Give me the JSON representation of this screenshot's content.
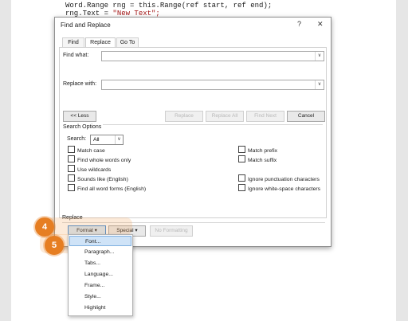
{
  "editor": {
    "code_line_1": "Word.Range rng = this.Range(ref start, ref end);",
    "code_line_2a": "rng.Text = ",
    "code_line_2b": "\"New Text\";"
  },
  "dialog": {
    "title": "Find and Replace",
    "help_label": "?",
    "close_label": "✕",
    "tabs": [
      {
        "label": "Find"
      },
      {
        "label": "Replace"
      },
      {
        "label": "Go To"
      }
    ],
    "find_label": "Find what:",
    "find_value": "",
    "replace_label": "Replace with:",
    "replace_value": "",
    "buttons": {
      "less": "<< Less",
      "replace": "Replace",
      "replace_all": "Replace All",
      "find_next": "Find Next",
      "cancel": "Cancel"
    },
    "search_options_label": "Search Options",
    "search_label": "Search:",
    "search_value": "All",
    "options_left": [
      "Match case",
      "Find whole words only",
      "Use wildcards",
      "Sounds like (English)",
      "Find all word forms (English)"
    ],
    "options_right": [
      "Match prefix",
      "Match suffix",
      "Ignore punctuation characters",
      "Ignore white-space characters"
    ],
    "replace_section_label": "Replace",
    "format_button": "Format ▾",
    "special_button": "Special ▾",
    "no_formatting_button": "No Formatting"
  },
  "format_menu": {
    "items": [
      "Font...",
      "Paragraph...",
      "Tabs...",
      "Language...",
      "Frame...",
      "Style...",
      "Highlight"
    ],
    "highlighted_index": 0
  },
  "badges": {
    "step4": "4",
    "step5": "5"
  },
  "colors": {
    "badge": "#e67e22",
    "highlight": "#cfe3f7"
  }
}
